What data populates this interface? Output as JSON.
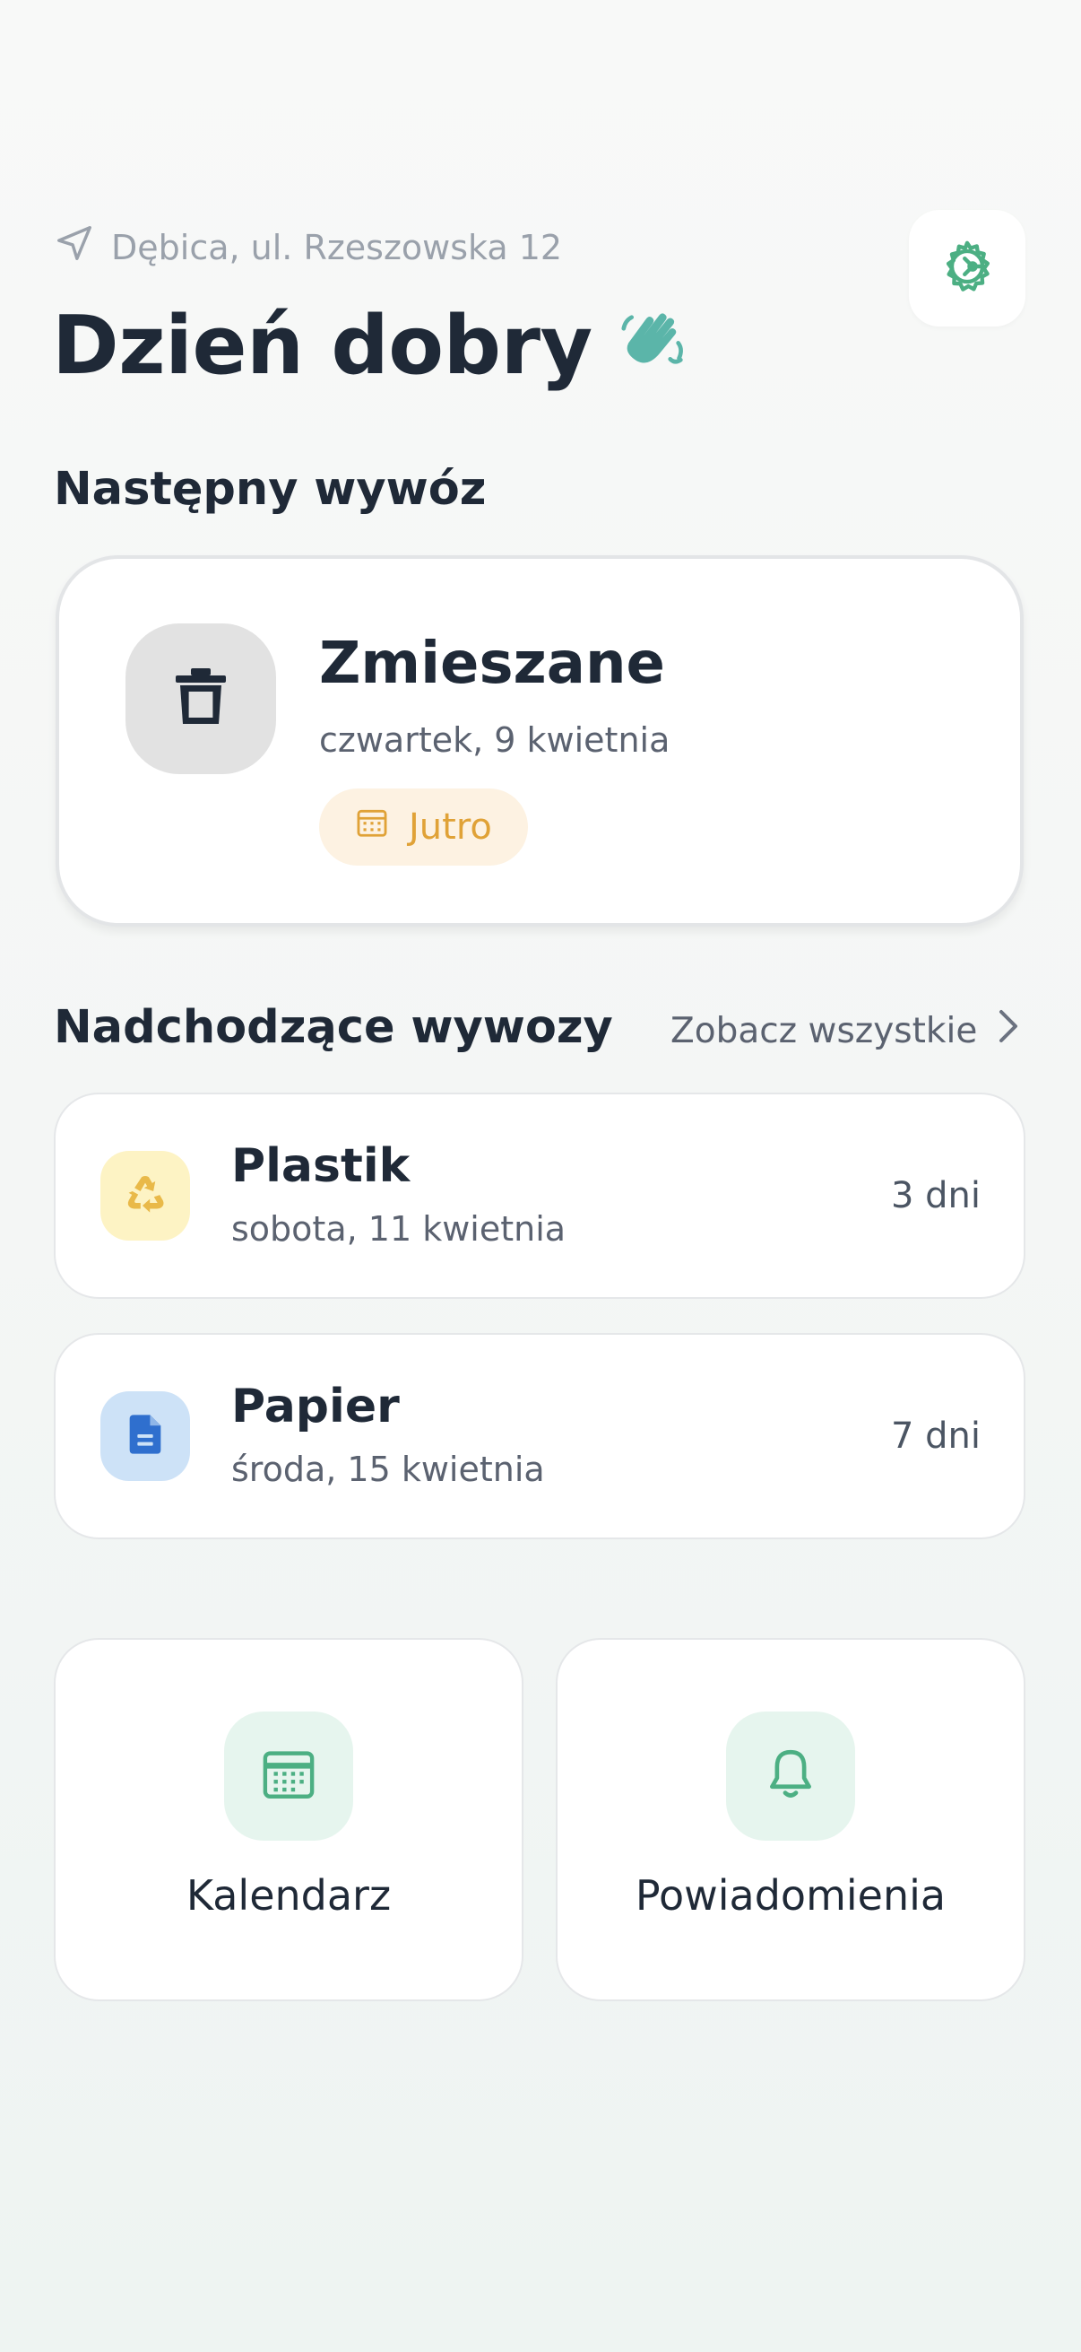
{
  "header": {
    "location": "Dębica, ul. Rzeszowska 12",
    "greeting": "Dzień dobry",
    "greeting_icon": "waving-hand-icon",
    "settings_icon": "gear-icon"
  },
  "next_pickup": {
    "section_title": "Następny wywóz",
    "type": "Zmieszane",
    "date": "czwartek, 9 kwietnia",
    "badge": "Jutro",
    "icon": "trash-bin-icon"
  },
  "upcoming": {
    "section_title": "Nadchodzące wywozy",
    "see_all": "Zobacz wszystkie",
    "items": [
      {
        "type": "Plastik",
        "date": "sobota, 11 kwietnia",
        "days": "3 dni",
        "icon": "recycle-icon",
        "icon_bg": "#fdf3c4",
        "icon_color": "#e9b949"
      },
      {
        "type": "Papier",
        "date": "środa, 15 kwietnia",
        "days": "7 dni",
        "icon": "document-icon",
        "icon_bg": "#cde2f7",
        "icon_color": "#2f6fce"
      }
    ]
  },
  "actions": [
    {
      "label": "Kalendarz",
      "icon": "calendar-icon"
    },
    {
      "label": "Powiadomienia",
      "icon": "bell-icon"
    }
  ],
  "colors": {
    "accent": "#4caf83",
    "wave": "#5bb5a9",
    "badge_text": "#e0a237",
    "badge_bg": "#fdf2e2",
    "text_primary": "#1f2937",
    "text_secondary": "#5b6270"
  }
}
